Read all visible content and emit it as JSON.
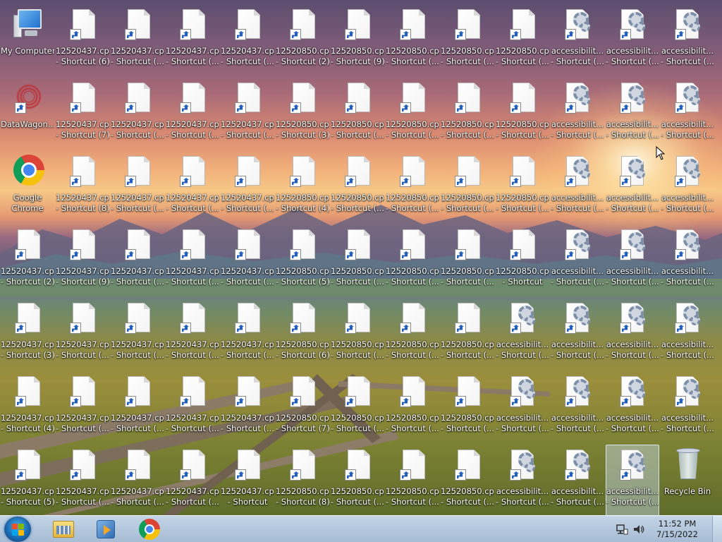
{
  "desktop": {
    "icons": [
      {
        "type": "computer",
        "l1": "My Computer",
        "l2": ""
      },
      {
        "type": "file",
        "l1": "12520437.cpx",
        "l2": "- Shortcut (6)"
      },
      {
        "type": "file",
        "l1": "12520437.cpx",
        "l2": "- Shortcut (..."
      },
      {
        "type": "file",
        "l1": "12520437.cpx",
        "l2": "- Shortcut (..."
      },
      {
        "type": "file",
        "l1": "12520437.cpx",
        "l2": "- Shortcut (..."
      },
      {
        "type": "file",
        "l1": "12520850.cpx",
        "l2": "- Shortcut (2)"
      },
      {
        "type": "file",
        "l1": "12520850.cpx",
        "l2": "- Shortcut (9)"
      },
      {
        "type": "file",
        "l1": "12520850.cpx",
        "l2": "- Shortcut (..."
      },
      {
        "type": "file",
        "l1": "12520850.cpx",
        "l2": "- Shortcut (..."
      },
      {
        "type": "file",
        "l1": "12520850.cpx",
        "l2": "- Shortcut (..."
      },
      {
        "type": "gear",
        "l1": "accessibilit...",
        "l2": "- Shortcut (..."
      },
      {
        "type": "gear",
        "l1": "accessibilit...",
        "l2": "- Shortcut (..."
      },
      {
        "type": "gear",
        "l1": "accessibilit...",
        "l2": "- Shortcut (..."
      },
      {
        "type": "datawagon",
        "l1": "DataWagon...",
        "l2": ""
      },
      {
        "type": "file",
        "l1": "12520437.cpx",
        "l2": "- Shortcut (7)"
      },
      {
        "type": "file",
        "l1": "12520437.cpx",
        "l2": "- Shortcut (..."
      },
      {
        "type": "file",
        "l1": "12520437.cpx",
        "l2": "- Shortcut (..."
      },
      {
        "type": "file",
        "l1": "12520437.cpx",
        "l2": "- Shortcut (..."
      },
      {
        "type": "file",
        "l1": "12520850.cpx",
        "l2": "- Shortcut (3)"
      },
      {
        "type": "file",
        "l1": "12520850.cpx",
        "l2": "- Shortcut (..."
      },
      {
        "type": "file",
        "l1": "12520850.cpx",
        "l2": "- Shortcut (..."
      },
      {
        "type": "file",
        "l1": "12520850.cpx",
        "l2": "- Shortcut (..."
      },
      {
        "type": "file",
        "l1": "12520850.cpx",
        "l2": "- Shortcut (..."
      },
      {
        "type": "gear",
        "l1": "accessibilit...",
        "l2": "- Shortcut (..."
      },
      {
        "type": "gear",
        "l1": "accessibilit...",
        "l2": "- Shortcut (..."
      },
      {
        "type": "gear",
        "l1": "accessibilit...",
        "l2": "- Shortcut (..."
      },
      {
        "type": "chrome",
        "l1": "Google",
        "l2": "Chrome"
      },
      {
        "type": "file",
        "l1": "12520437.cpx",
        "l2": "- Shortcut (8)"
      },
      {
        "type": "file",
        "l1": "12520437.cpx",
        "l2": "- Shortcut (..."
      },
      {
        "type": "file",
        "l1": "12520437.cpx",
        "l2": "- Shortcut (..."
      },
      {
        "type": "file",
        "l1": "12520437.cpx",
        "l2": "- Shortcut (..."
      },
      {
        "type": "file",
        "l1": "12520850.cpx",
        "l2": "- Shortcut (4)"
      },
      {
        "type": "file",
        "l1": "12520850.cpx",
        "l2": "- Shortcut (..."
      },
      {
        "type": "file",
        "l1": "12520850.cpx",
        "l2": "- Shortcut (..."
      },
      {
        "type": "file",
        "l1": "12520850.cpx",
        "l2": "- Shortcut (..."
      },
      {
        "type": "file",
        "l1": "12520850.cpx",
        "l2": "- Shortcut (..."
      },
      {
        "type": "gear",
        "l1": "accessibilit...",
        "l2": "- Shortcut (..."
      },
      {
        "type": "gear",
        "l1": "accessibilit...",
        "l2": "- Shortcut (..."
      },
      {
        "type": "gear",
        "l1": "accessibilit...",
        "l2": "- Shortcut (..."
      },
      {
        "type": "file",
        "l1": "12520437.cpx",
        "l2": "- Shortcut (2)"
      },
      {
        "type": "file",
        "l1": "12520437.cpx",
        "l2": "- Shortcut (9)"
      },
      {
        "type": "file",
        "l1": "12520437.cpx",
        "l2": "- Shortcut (..."
      },
      {
        "type": "file",
        "l1": "12520437.cpx",
        "l2": "- Shortcut (..."
      },
      {
        "type": "file",
        "l1": "12520437.cpx",
        "l2": "- Shortcut (..."
      },
      {
        "type": "file",
        "l1": "12520850.cpx",
        "l2": "- Shortcut (5)"
      },
      {
        "type": "file",
        "l1": "12520850.cpx",
        "l2": "- Shortcut (..."
      },
      {
        "type": "file",
        "l1": "12520850.cpx",
        "l2": "- Shortcut (..."
      },
      {
        "type": "file",
        "l1": "12520850.cpx",
        "l2": "- Shortcut (..."
      },
      {
        "type": "file",
        "l1": "12520850.cpx",
        "l2": "- Shortcut"
      },
      {
        "type": "gear",
        "l1": "accessibilit...",
        "l2": "- Shortcut (..."
      },
      {
        "type": "gear",
        "l1": "accessibilit...",
        "l2": "- Shortcut (..."
      },
      {
        "type": "gear",
        "l1": "accessibilit...",
        "l2": "- Shortcut (..."
      },
      {
        "type": "file",
        "l1": "12520437.cpx",
        "l2": "- Shortcut (3)"
      },
      {
        "type": "file",
        "l1": "12520437.cpx",
        "l2": "- Shortcut (..."
      },
      {
        "type": "file",
        "l1": "12520437.cpx",
        "l2": "- Shortcut (..."
      },
      {
        "type": "file",
        "l1": "12520437.cpx",
        "l2": "- Shortcut (..."
      },
      {
        "type": "file",
        "l1": "12520437.cpx",
        "l2": "- Shortcut (..."
      },
      {
        "type": "file",
        "l1": "12520850.cpx",
        "l2": "- Shortcut (6)"
      },
      {
        "type": "file",
        "l1": "12520850.cpx",
        "l2": "- Shortcut (..."
      },
      {
        "type": "file",
        "l1": "12520850.cpx",
        "l2": "- Shortcut (..."
      },
      {
        "type": "file",
        "l1": "12520850.cpx",
        "l2": "- Shortcut (..."
      },
      {
        "type": "gear",
        "l1": "accessibilit...",
        "l2": "- Shortcut (..."
      },
      {
        "type": "gear",
        "l1": "accessibilit...",
        "l2": "- Shortcut (..."
      },
      {
        "type": "gear",
        "l1": "accessibilit...",
        "l2": "- Shortcut (..."
      },
      {
        "type": "gear",
        "l1": "accessibilit...",
        "l2": "- Shortcut (..."
      },
      {
        "type": "file",
        "l1": "12520437.cpx",
        "l2": "- Shortcut (4)"
      },
      {
        "type": "file",
        "l1": "12520437.cpx",
        "l2": "- Shortcut (..."
      },
      {
        "type": "file",
        "l1": "12520437.cpx",
        "l2": "- Shortcut (..."
      },
      {
        "type": "file",
        "l1": "12520437.cpx",
        "l2": "- Shortcut (..."
      },
      {
        "type": "file",
        "l1": "12520437.cpx",
        "l2": "- Shortcut (..."
      },
      {
        "type": "file",
        "l1": "12520850.cpx",
        "l2": "- Shortcut (7)"
      },
      {
        "type": "file",
        "l1": "12520850.cpx",
        "l2": "- Shortcut (..."
      },
      {
        "type": "file",
        "l1": "12520850.cpx",
        "l2": "- Shortcut (..."
      },
      {
        "type": "file",
        "l1": "12520850.cpx",
        "l2": "- Shortcut (..."
      },
      {
        "type": "gear",
        "l1": "accessibilit...",
        "l2": "- Shortcut (..."
      },
      {
        "type": "gear",
        "l1": "accessibilit...",
        "l2": "- Shortcut (..."
      },
      {
        "type": "gear",
        "l1": "accessibilit...",
        "l2": "- Shortcut (..."
      },
      {
        "type": "gear",
        "l1": "accessibilit...",
        "l2": "- Shortcut (..."
      },
      {
        "type": "file",
        "l1": "12520437.cpx",
        "l2": "- Shortcut (5)"
      },
      {
        "type": "file",
        "l1": "12520437.cpx",
        "l2": "- Shortcut (..."
      },
      {
        "type": "file",
        "l1": "12520437.cpx",
        "l2": "- Shortcut (..."
      },
      {
        "type": "file",
        "l1": "12520437.cpx",
        "l2": "- Shortcut (..."
      },
      {
        "type": "file",
        "l1": "12520437.cpx",
        "l2": "- Shortcut"
      },
      {
        "type": "file",
        "l1": "12520850.cpx",
        "l2": "- Shortcut (8)"
      },
      {
        "type": "file",
        "l1": "12520850.cpx",
        "l2": "- Shortcut (..."
      },
      {
        "type": "file",
        "l1": "12520850.cpx",
        "l2": "- Shortcut (..."
      },
      {
        "type": "file",
        "l1": "12520850.cpx",
        "l2": "- Shortcut (..."
      },
      {
        "type": "gear",
        "l1": "accessibilit...",
        "l2": "- Shortcut (..."
      },
      {
        "type": "gear",
        "l1": "accessibilit...",
        "l2": "- Shortcut (..."
      },
      {
        "type": "gear",
        "l1": "accessibilit...",
        "l2": "- Shortcut (...",
        "selected": true
      },
      {
        "type": "bin",
        "l1": "Recycle Bin",
        "l2": ""
      }
    ]
  },
  "taskbar": {
    "pinned": [
      "windows-explorer-icon",
      "media-player-icon",
      "chrome-icon"
    ],
    "clock": {
      "time": "11:52 PM",
      "date": "7/15/2022"
    }
  },
  "colors": {
    "taskbar": "#b9cde2",
    "label_text": "#ffffff",
    "selection": "#c8dcf0"
  }
}
